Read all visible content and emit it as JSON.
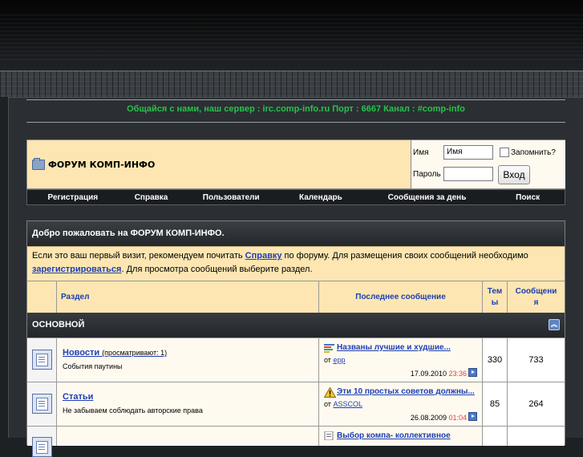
{
  "irc_notice": "Общайся с нами, наш сервер : irc.comp-info.ru Порт : 6667 Канал : #comp-info",
  "header": {
    "forum_title": "ФОРУМ КОМП-ИНФО",
    "login": {
      "username_label": "Имя",
      "username_value": "Имя",
      "password_label": "Пароль",
      "remember_label": "Запомнить?",
      "submit_label": "Вход"
    }
  },
  "nav": [
    "Регистрация",
    "Справка",
    "Пользователи",
    "Календарь",
    "Сообщения за день",
    "Поиск"
  ],
  "welcome": {
    "title": "Добро пожаловать на ФОРУМ КОМП-ИНФО.",
    "text_before": "Если это ваш первый визит, рекомендуем почитать ",
    "help_link": "Справку",
    "text_middle": " по форуму. Для размещения своих сообщений необходимо ",
    "register_link": "зарегистрироваться",
    "text_after": ". Для просмотра сообщений выберите раздел."
  },
  "columns": {
    "forum": "Раздел",
    "last_post": "Последнее сообщение",
    "threads_l1": "Тем",
    "threads_l2": "ы",
    "posts_l1": "Сообщени",
    "posts_l2": "я"
  },
  "category": {
    "name": "ОСНОВНОЙ"
  },
  "forums": [
    {
      "name": "Новости",
      "viewing": "(просматривают: 1)",
      "description": "События паутины",
      "last_title": "Названы лучшие и худшие...",
      "by_label": "от",
      "last_author": "epp",
      "last_date": "17.09.2010",
      "last_time": "23:36",
      "threads": "330",
      "posts": "733"
    },
    {
      "name": "Статьи",
      "viewing": "",
      "description": "Не забываем соблюдать авторские права",
      "last_title": "Эти 10 простых советов должны...",
      "by_label": "от",
      "last_author": "ASSCOL",
      "last_date": "26.08.2009",
      "last_time": "01:04",
      "threads": "85",
      "posts": "264"
    },
    {
      "last_title": "Выбор компа- коллективное"
    }
  ]
}
